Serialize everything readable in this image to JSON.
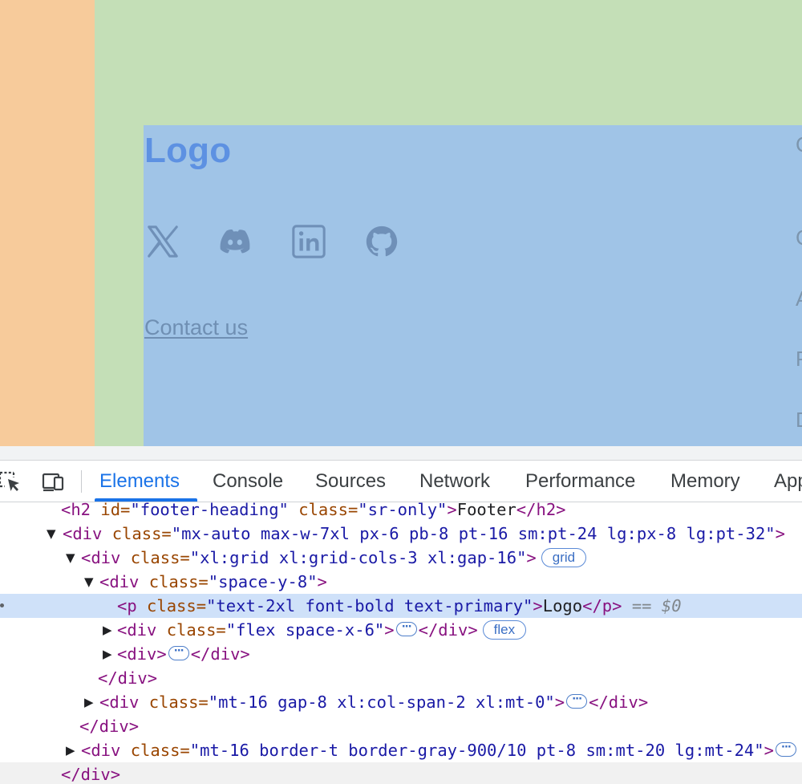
{
  "page": {
    "logo_text": "Logo",
    "social_icons": [
      "x-icon",
      "discord-icon",
      "linkedin-icon",
      "github-icon"
    ],
    "contact_link": "Contact us",
    "edge_chars": [
      "C",
      "C",
      "A",
      "P",
      "D"
    ]
  },
  "devtools": {
    "tabs": [
      "Elements",
      "Console",
      "Sources",
      "Network",
      "Performance",
      "Memory",
      "Application"
    ],
    "active_tab": "Elements",
    "tree": {
      "l1_open": "<h2",
      "l1_attr1_name": "id=",
      "l1_attr1_val": "\"footer-heading\"",
      "l1_attr2_name": "class=",
      "l1_attr2_val": "\"sr-only\"",
      "l1_gt": ">",
      "l1_text": "Footer",
      "l1_close": "</h2>",
      "l2_open": "<div",
      "l2_attr_name": "class=",
      "l2_attr_val": "\"mx-auto max-w-7xl px-6 pb-8 pt-16 sm:pt-24 lg:px-8 lg:pt-32\"",
      "l2_gt": ">",
      "l3_open": "<div",
      "l3_attr_name": "class=",
      "l3_attr_val": "\"xl:grid xl:grid-cols-3 xl:gap-16\"",
      "l3_gt": ">",
      "l3_badge": "grid",
      "l4_open": "<div",
      "l4_attr_name": "class=",
      "l4_attr_val": "\"space-y-8\"",
      "l4_gt": ">",
      "l5_open": "<p",
      "l5_attr_name": "class=",
      "l5_attr_val": "\"text-2xl font-bold text-primary\"",
      "l5_gt": ">",
      "l5_text": "Logo",
      "l5_close": "</p>",
      "l5_marker": "== $0",
      "l6_open": "<div",
      "l6_attr_name": "class=",
      "l6_attr_val": "\"flex space-x-6\"",
      "l6_gt": ">",
      "l6_close": "</div>",
      "l6_badge": "flex",
      "l7_open": "<div>",
      "l7_close": "</div>",
      "l8_close": "</div>",
      "l9_open": "<div",
      "l9_attr_name": "class=",
      "l9_attr_val": "\"mt-16 gap-8 xl:col-span-2 xl:mt-0\"",
      "l9_gt": ">",
      "l9_close": "</div>",
      "l10_close": "</div>",
      "l11_open": "<div",
      "l11_attr_name": "class=",
      "l11_attr_val": "\"mt-16 border-t border-gray-900/10 pt-8 sm:mt-20 lg:mt-24\"",
      "l11_gt": ">",
      "l12_close": "</div>"
    }
  },
  "colors": {
    "margin": "#f7cb9b",
    "padding": "#c4dfb7",
    "content": "#a0c4e7",
    "logo": "#5d91e2",
    "active_tab": "#1a73e8",
    "selected_row": "#cfe1f9"
  }
}
